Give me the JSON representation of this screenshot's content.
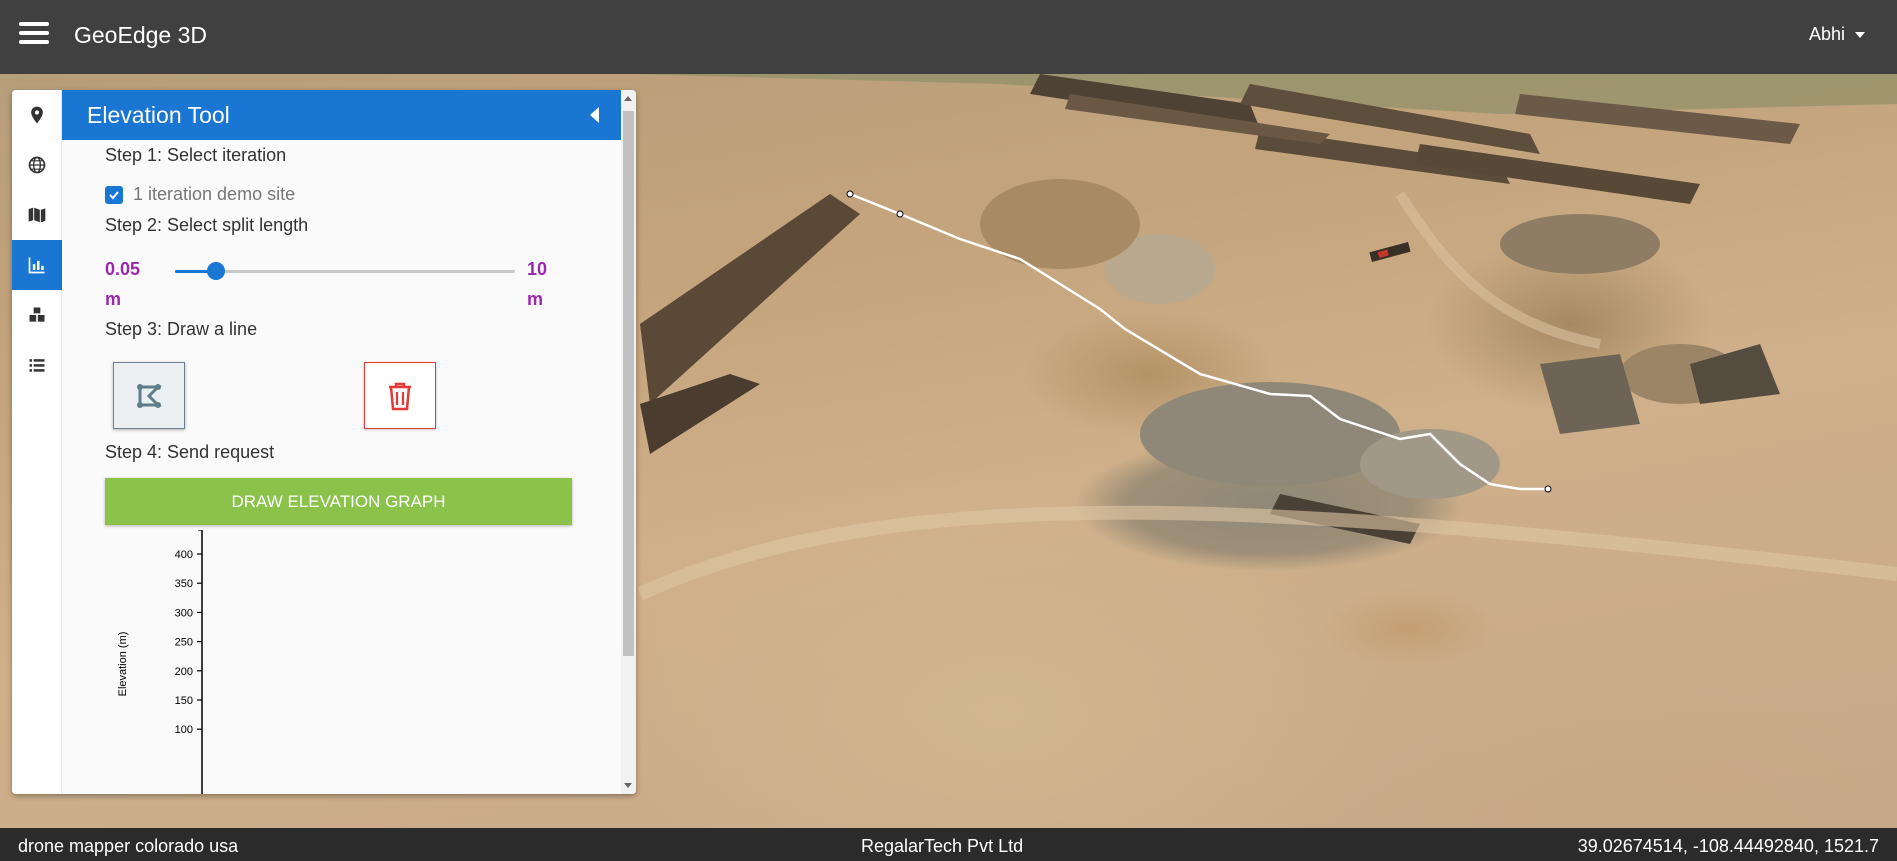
{
  "header": {
    "app_title": "GeoEdge 3D",
    "user_name": "Abhi"
  },
  "sidebar": {
    "items": [
      {
        "icon": "map-marker-icon",
        "active": false
      },
      {
        "icon": "globe-icon",
        "active": false
      },
      {
        "icon": "map-icon",
        "active": false
      },
      {
        "icon": "bar-chart-icon",
        "active": true
      },
      {
        "icon": "cubes-icon",
        "active": false
      },
      {
        "icon": "list-icon",
        "active": false
      }
    ]
  },
  "elevation_tool": {
    "title": "Elevation Tool",
    "step1_label": "Step 1: Select iteration",
    "iteration_label": "1 iteration demo site",
    "iteration_checked": true,
    "step2_label": "Step 2: Select split length",
    "slider_min_value": "0.05",
    "slider_min_unit": "m",
    "slider_max_value": "10",
    "slider_max_unit": "m",
    "slider_position": 0.12,
    "step3_label": "Step 3: Draw a line",
    "draw_line_icon": "draw-polyline-icon",
    "delete_icon": "trash-icon",
    "step4_label": "Step 4: Send request",
    "graph_button_label": "DRAW ELEVATION GRAPH"
  },
  "chart_data": {
    "type": "line",
    "ylabel": "Elevation (m)",
    "y_ticks": [
      400,
      350,
      300,
      250,
      200,
      150,
      100
    ],
    "series": []
  },
  "footer": {
    "site_name": "drone mapper colorado usa",
    "company": "RegalarTech Pvt Ltd",
    "coordinates": "39.02674514, -108.44492840, 1521.7"
  },
  "colors": {
    "topbar": "#404040",
    "accent_blue": "#1976d2",
    "slider_label": "#9c27b0",
    "graph_button": "#8bc34a",
    "delete_red": "#e53935"
  }
}
